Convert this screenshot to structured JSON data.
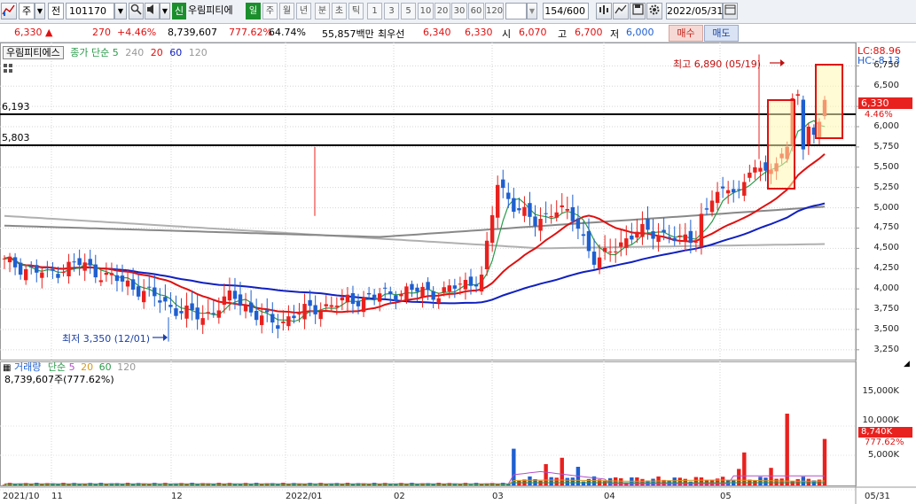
{
  "toolbar": {
    "type_label": "주",
    "market_label": "전",
    "code_value": "101170",
    "new_badge": "신",
    "stock_name": "우림피티에",
    "periods": [
      "일",
      "주",
      "월",
      "년",
      "분",
      "초",
      "틱"
    ],
    "intervals": [
      "1",
      "3",
      "5",
      "10",
      "20",
      "30",
      "60",
      "120"
    ],
    "bar_count": "154/600",
    "date_value": "2022/05/31"
  },
  "quote": {
    "price": "6,330 ▲",
    "change": "270",
    "change_pct": "+4.46%",
    "volume": "8,739,607",
    "volume_ratio": "777.62%",
    "turnover": "64.74%",
    "amount": "55,857백만",
    "best_ask_label": "최우선",
    "best_ask": "6,340",
    "best_bid": "6,330",
    "open_label": "시",
    "open": "6,070",
    "high_label": "고",
    "high": "6,700",
    "low_label": "저",
    "low": "6,000",
    "buy_label": "매수",
    "sell_label": "매도"
  },
  "price_panel": {
    "name": "우림피티에스",
    "ma_label": "종가 단순",
    "ma_periods": [
      "5",
      "240",
      "20",
      "60",
      "120"
    ],
    "lc_label": "LC:88.96",
    "hc_label": "HC:-8.13",
    "hline1": "6,193",
    "hline2": "5,803",
    "max_annot": "최고 6,890 (05/19)",
    "min_annot": "최저 3,350 (12/01)",
    "price_tag": "6,330",
    "pct_tag": "4.46%",
    "y_ticks": [
      "6,750",
      "6,500",
      "6,250",
      "6,000",
      "5,750",
      "5,500",
      "5,250",
      "5,000",
      "4,750",
      "4,500",
      "4,250",
      "4,000",
      "3,750",
      "3,500",
      "3,250"
    ]
  },
  "volume_panel": {
    "label": "거래량",
    "ma_label": "단순",
    "ma_periods": [
      "5",
      "20",
      "60",
      "120"
    ],
    "value_text": "8,739,607주(777.62%)",
    "y_ticks": [
      "15,000K",
      "10,000K",
      "5,000K"
    ],
    "vol_tag": "8,740K",
    "vol_pct_tag": "777.62%"
  },
  "x_axis": [
    "2021/10",
    "11",
    "12",
    "2022/01",
    "02",
    "03",
    "04",
    "05",
    "05/31"
  ],
  "colors": {
    "up": "#e8211e",
    "down": "#1e5fd0",
    "ma5": "#2a9a4a",
    "ma20": "#e01010",
    "ma60": "#1020c0",
    "ma120": "#7a7a7a",
    "ma240": "#b0b0b0"
  }
}
